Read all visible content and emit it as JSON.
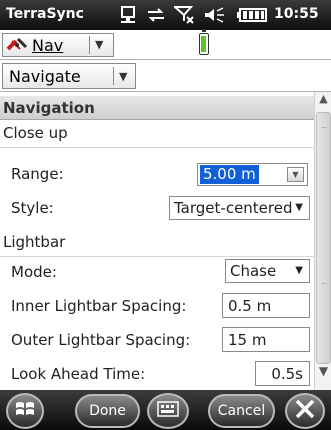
{
  "titlebar": {
    "app_name": "TerraSync",
    "time": "10:55",
    "icons": [
      "connectivity-icon",
      "sync-arrows-icon",
      "signal-off-icon",
      "volume-icon",
      "battery-icon"
    ]
  },
  "toolbar": {
    "nav_label": "Nav",
    "navigate_label": "Navigate",
    "battery_color": "#5ec22a"
  },
  "section": {
    "title": "Navigation"
  },
  "close_up": {
    "group_label": "Close up",
    "range_label": "Range:",
    "range_value": "5.00 m",
    "style_label": "Style:",
    "style_value": "Target-centered"
  },
  "lightbar": {
    "group_label": "Lightbar",
    "mode_label": "Mode:",
    "mode_value": "Chase",
    "inner_label": "Inner Lightbar Spacing:",
    "inner_value": "0.5 m",
    "outer_label": "Outer Lightbar Spacing:",
    "outer_value": "15 m",
    "lookahead_label": "Look Ahead Time:",
    "lookahead_value": "0.5s"
  },
  "bottombar": {
    "done_label": "Done",
    "cancel_label": "Cancel"
  },
  "colors": {
    "selection": "#1160d8",
    "bar_dark": "#0a0a0a"
  }
}
